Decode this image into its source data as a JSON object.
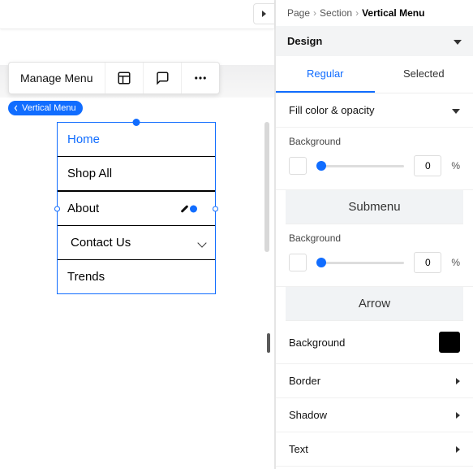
{
  "toolbar": {
    "manage_label": "Manage Menu"
  },
  "tag_label": "Vertical Menu",
  "menu": {
    "items": [
      {
        "label": "Home"
      },
      {
        "label": "Shop All"
      },
      {
        "label": "About"
      },
      {
        "label": "Contact Us"
      },
      {
        "label": "Trends"
      }
    ]
  },
  "breadcrumb": {
    "a": "Page",
    "b": "Section",
    "c": "Vertical Menu"
  },
  "design": {
    "title": "Design",
    "tabs": {
      "regular": "Regular",
      "selected": "Selected"
    },
    "fill_row": "Fill color & opacity",
    "bg_label": "Background",
    "bg_value_1": "0",
    "bg_unit": "%",
    "submenu_title": "Submenu",
    "bg_value_2": "0",
    "arrow_title": "Arrow",
    "arrow_bg_label": "Background",
    "rows": {
      "border": "Border",
      "shadow": "Shadow",
      "text": "Text"
    }
  }
}
